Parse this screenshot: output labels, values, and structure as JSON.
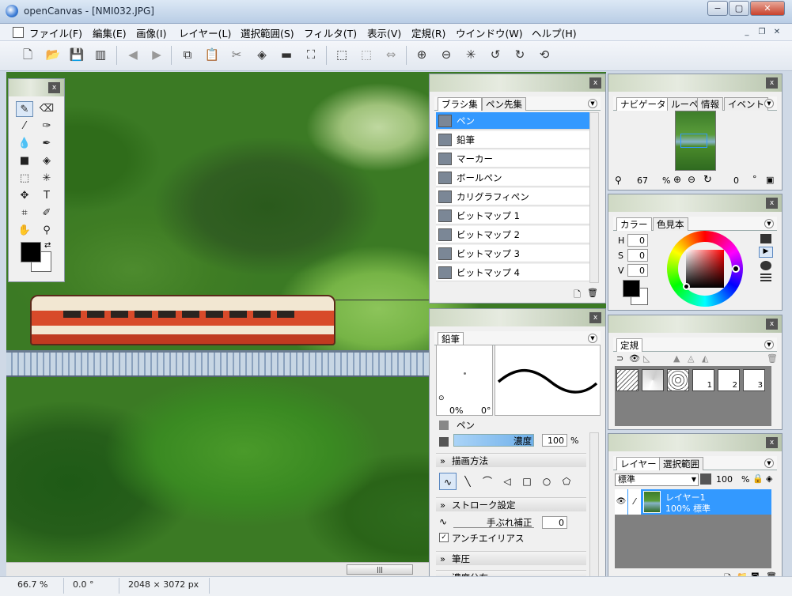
{
  "window": {
    "title": "openCanvas - [NMI032.JPG]",
    "minimize": "−",
    "maximize": "▢",
    "close": "✕"
  },
  "menu": [
    "ファイル(F)",
    "編集(E)",
    "画像(I)",
    "レイヤー(L)",
    "選択範囲(S)",
    "フィルタ(T)",
    "表示(V)",
    "定規(R)",
    "ウインドウ(W)",
    "ヘルプ(H)"
  ],
  "brush_panel": {
    "tabs": [
      "ブラシ集",
      "ペン先集"
    ],
    "items": [
      "ペン",
      "鉛筆",
      "マーカー",
      "ボールペン",
      "カリグラフィペン",
      "ビットマップ 1",
      "ビットマップ 2",
      "ビットマップ 3",
      "ビットマップ 4"
    ],
    "selected": "ペン"
  },
  "pencil_panel": {
    "tab": "鉛筆",
    "size": "0%",
    "angle": "0°",
    "tip_name": "ペン",
    "density_label": "濃度",
    "density_value": "100",
    "density_unit": "%",
    "section_draw": "描画方法",
    "section_stroke": "ストローク設定",
    "stabilizer_label": "手ぶれ補正",
    "stabilizer_value": "0",
    "antialias_label": "アンチエイリアス",
    "section_pressure": "筆圧",
    "section_density_dist": "濃度分布"
  },
  "nav_panel": {
    "tabs": [
      "ナビゲータ",
      "ルーペ",
      "情報",
      "イベント"
    ],
    "zoom": "67",
    "zoom_unit": "%",
    "rotation": "0",
    "rotation_unit": "°"
  },
  "color_panel": {
    "tabs": [
      "カラー",
      "色見本"
    ],
    "h_label": "H",
    "h": "0",
    "s_label": "S",
    "s": "0",
    "v_label": "V",
    "v": "0"
  },
  "ruler_panel": {
    "tabs": [
      "定規"
    ],
    "presets": [
      "1",
      "2",
      "3"
    ]
  },
  "layer_panel": {
    "tabs": [
      "レイヤー",
      "選択範囲"
    ],
    "blend": "標準",
    "opacity": "100",
    "opacity_unit": "%",
    "layer_name": "レイヤー1",
    "layer_info": "100% 標準"
  },
  "status": {
    "zoom": "66.7 %",
    "angle": "0.0 °",
    "size": "2048 × 3072 px"
  },
  "colors": {
    "accent": "#3399ff",
    "fg": "#000000",
    "bg": "#ffffff"
  }
}
